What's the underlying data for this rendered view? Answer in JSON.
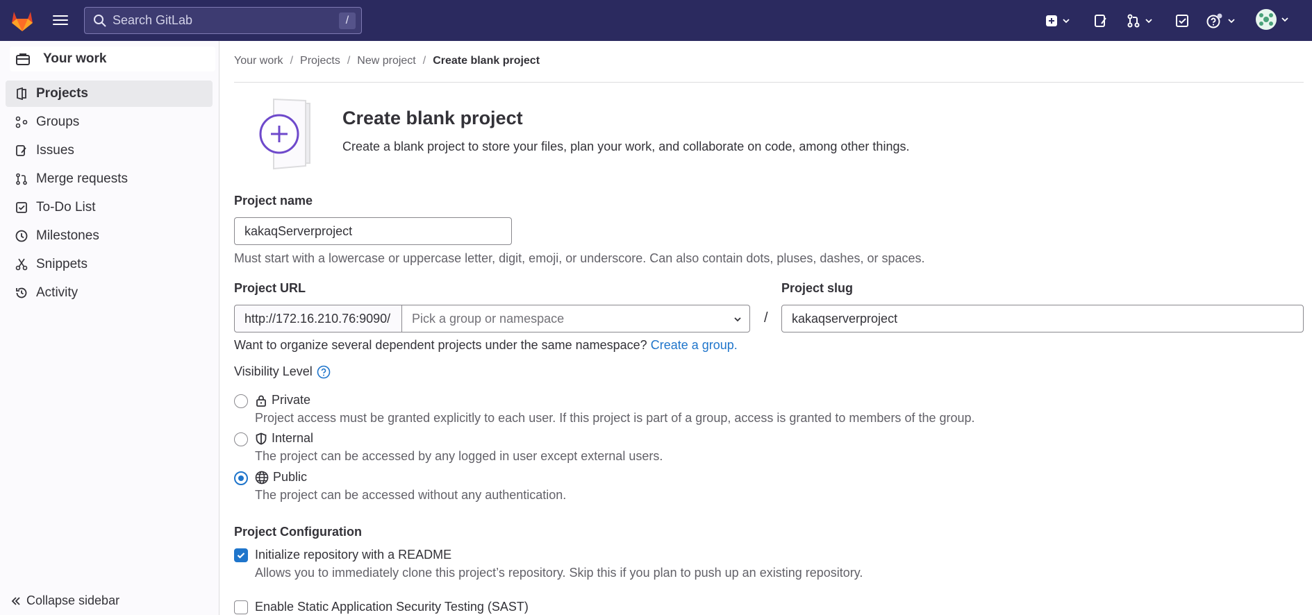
{
  "topbar": {
    "search_placeholder": "Search GitLab",
    "search_shortcut": "/"
  },
  "sidebar": {
    "header": "Your work",
    "items": [
      {
        "label": "Projects",
        "active": true
      },
      {
        "label": "Groups"
      },
      {
        "label": "Issues"
      },
      {
        "label": "Merge requests"
      },
      {
        "label": "To-Do List"
      },
      {
        "label": "Milestones"
      },
      {
        "label": "Snippets"
      },
      {
        "label": "Activity"
      }
    ],
    "collapse_label": "Collapse sidebar"
  },
  "breadcrumb": [
    "Your work",
    "Projects",
    "New project",
    "Create blank project"
  ],
  "page": {
    "title": "Create blank project",
    "description": "Create a blank project to store your files, plan your work, and collaborate on code, among other things."
  },
  "form": {
    "project_name_label": "Project name",
    "project_name_value": "kakaqServerproject",
    "project_name_help": "Must start with a lowercase or uppercase letter, digit, emoji, or underscore. Can also contain dots, pluses, dashes, or spaces.",
    "project_url_label": "Project URL",
    "project_url_prefix": "http://172.16.210.76:9090/",
    "namespace_placeholder": "Pick a group or namespace",
    "url_separator": "/",
    "project_slug_label": "Project slug",
    "project_slug_value": "kakaqserverproject",
    "namespace_help": "Want to organize several dependent projects under the same namespace?",
    "create_group_link": "Create a group."
  },
  "visibility": {
    "label": "Visibility Level",
    "options": [
      {
        "label": "Private",
        "description": "Project access must be granted explicitly to each user. If this project is part of a group, access is granted to members of the group.",
        "selected": false,
        "icon": "lock-icon"
      },
      {
        "label": "Internal",
        "description": "The project can be accessed by any logged in user except external users.",
        "selected": false,
        "icon": "shield-icon"
      },
      {
        "label": "Public",
        "description": "The project can be accessed without any authentication.",
        "selected": true,
        "icon": "globe-icon"
      }
    ]
  },
  "configuration": {
    "label": "Project Configuration",
    "readme_label": "Initialize repository with a README",
    "readme_checked": true,
    "readme_help": "Allows you to immediately clone this project’s repository. Skip this if you plan to push up an existing repository.",
    "sast_label": "Enable Static Application Security Testing (SAST)",
    "sast_checked": false
  },
  "colors": {
    "topbar": "#2b2a5f",
    "accent": "#1f75cb",
    "illustration": "#6e49cb"
  }
}
